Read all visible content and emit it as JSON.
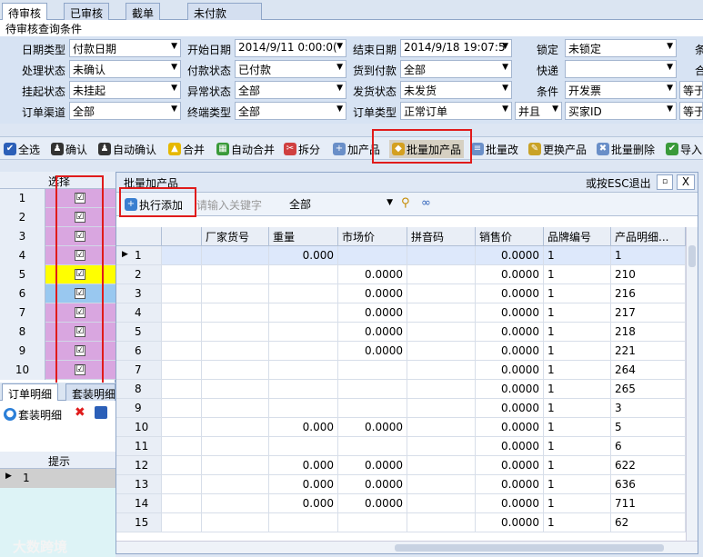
{
  "tabs": [
    "待审核",
    "已审核",
    "截单",
    "未付款"
  ],
  "query_title": "待审核查询条件",
  "filters": [
    {
      "label": "日期类型",
      "value": "付款日期"
    },
    {
      "label": "开始日期",
      "value": "2014/9/11 0:00:0("
    },
    {
      "label": "结束日期",
      "value": "2014/9/18 19:07:5"
    },
    {
      "label": "锁定",
      "value": "未锁定"
    },
    {
      "label": "处理状态",
      "value": "未确认"
    },
    {
      "label": "付款状态",
      "value": "已付款"
    },
    {
      "label": "货到付款",
      "value": "全部"
    },
    {
      "label": "快递",
      "value": ""
    },
    {
      "label": "挂起状态",
      "value": "未挂起"
    },
    {
      "label": "异常状态",
      "value": "全部"
    },
    {
      "label": "发货状态",
      "value": "未发货"
    },
    {
      "label": "条件",
      "value": "开发票"
    },
    {
      "label": "订单渠道",
      "value": "全部"
    },
    {
      "label": "终端类型",
      "value": "全部"
    },
    {
      "label": "订单类型",
      "value": "正常订单"
    },
    {
      "label": "",
      "value": "并且"
    },
    {
      "label": "",
      "value": "买家ID"
    }
  ],
  "right_labels": [
    "条",
    "合",
    "等于",
    "等于"
  ],
  "toolbar": [
    "全选",
    "确认",
    "自动确认",
    "合并",
    "自动合并",
    "拆分",
    "加产品",
    "批量加产品",
    "批量改",
    "更换产品",
    "批量删除",
    "导入"
  ],
  "left_grid": {
    "header": "选择",
    "rows": [
      "1",
      "2",
      "3",
      "4",
      "5",
      "6",
      "7",
      "8",
      "9",
      "10"
    ],
    "checked": "☑",
    "row_colors": [
      "#d9a6e0",
      "#d9a6e0",
      "#d9a6e0",
      "#d9a6e0",
      "#ffff00",
      "#99c8f0",
      "#d9a6e0",
      "#d9a6e0",
      "#d9a6e0",
      "#d9a6e0"
    ]
  },
  "bottom_tabs": [
    "订单明细",
    "套装明细"
  ],
  "bottom_toolbar": {
    "label": "套装明细"
  },
  "bottom_grid": {
    "header": "提示",
    "row": "1"
  },
  "watermark": "大数跨境",
  "panel": {
    "title": "批量加产品",
    "esc_hint": "或按ESC退出",
    "close": "X",
    "exec_button": "执行添加",
    "search_placeholder": "请输入关键字",
    "scope": "全部",
    "columns": [
      "",
      "",
      "厂家货号",
      "重量",
      "市场价",
      "拼音码",
      "销售价",
      "品牌编号",
      "产品明细..."
    ],
    "rows": [
      {
        "n": "1",
        "weight": "0.000",
        "market": "",
        "price": "0.0000",
        "brand": "1",
        "detail": "1"
      },
      {
        "n": "2",
        "weight": "",
        "market": "0.0000",
        "price": "0.0000",
        "brand": "1",
        "detail": "210"
      },
      {
        "n": "3",
        "weight": "",
        "market": "0.0000",
        "price": "0.0000",
        "brand": "1",
        "detail": "216"
      },
      {
        "n": "4",
        "weight": "",
        "market": "0.0000",
        "price": "0.0000",
        "brand": "1",
        "detail": "217"
      },
      {
        "n": "5",
        "weight": "",
        "market": "0.0000",
        "price": "0.0000",
        "brand": "1",
        "detail": "218"
      },
      {
        "n": "6",
        "weight": "",
        "market": "0.0000",
        "price": "0.0000",
        "brand": "1",
        "detail": "221"
      },
      {
        "n": "7",
        "weight": "",
        "market": "",
        "price": "0.0000",
        "brand": "1",
        "detail": "264"
      },
      {
        "n": "8",
        "weight": "",
        "market": "",
        "price": "0.0000",
        "brand": "1",
        "detail": "265"
      },
      {
        "n": "9",
        "weight": "",
        "market": "",
        "price": "0.0000",
        "brand": "1",
        "detail": "3"
      },
      {
        "n": "10",
        "weight": "0.000",
        "market": "0.0000",
        "price": "0.0000",
        "brand": "1",
        "detail": "5"
      },
      {
        "n": "11",
        "weight": "",
        "market": "",
        "price": "0.0000",
        "brand": "1",
        "detail": "6"
      },
      {
        "n": "12",
        "weight": "0.000",
        "market": "0.0000",
        "price": "0.0000",
        "brand": "1",
        "detail": "622"
      },
      {
        "n": "13",
        "weight": "0.000",
        "market": "0.0000",
        "price": "0.0000",
        "brand": "1",
        "detail": "636"
      },
      {
        "n": "14",
        "weight": "0.000",
        "market": "0.0000",
        "price": "0.0000",
        "brand": "1",
        "detail": "711"
      },
      {
        "n": "15",
        "weight": "",
        "market": "",
        "price": "0.0000",
        "brand": "1",
        "detail": "62"
      }
    ]
  },
  "colors": {
    "highlight_red": "#e01b1b",
    "lilac": "#d9a6e0",
    "yellow": "#ffff00",
    "blue": "#99c8f0",
    "selected_row": "#dde8fb"
  }
}
